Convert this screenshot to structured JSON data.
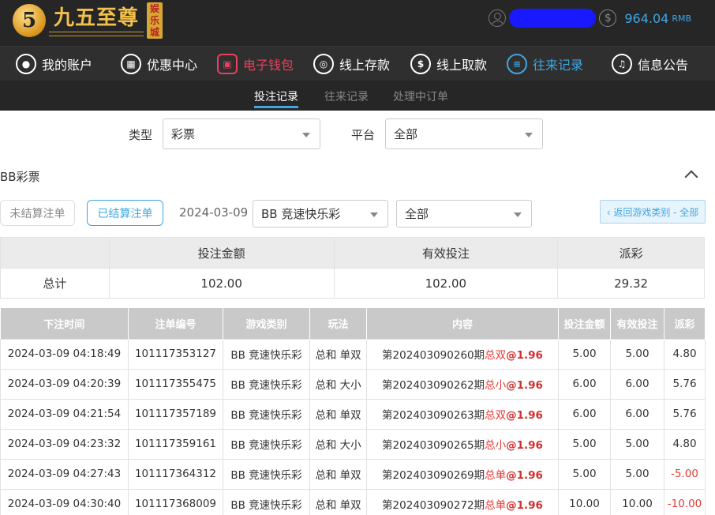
{
  "header": {
    "logo_title": "九五至尊",
    "logo_badge": "娱乐城",
    "balance": "964.04",
    "balance_unit": "RMB"
  },
  "mainnav": [
    {
      "label": "我的账户",
      "icon": "user-icon"
    },
    {
      "label": "优惠中心",
      "icon": "gift-icon"
    },
    {
      "label": "电子钱包",
      "icon": "wallet-icon"
    },
    {
      "label": "线上存款",
      "icon": "deposit-icon"
    },
    {
      "label": "线上取款",
      "icon": "withdraw-icon"
    },
    {
      "label": "往来记录",
      "icon": "records-icon"
    },
    {
      "label": "信息公告",
      "icon": "bell-icon"
    }
  ],
  "subnav": [
    "投注记录",
    "往来记录",
    "处理中订单"
  ],
  "filters": {
    "type_label": "类型",
    "type_value": "彩票",
    "platform_label": "平台",
    "platform_value": "全部"
  },
  "section": {
    "title": "BB彩票",
    "unsettled_label": "未结算注单",
    "settled_label": "已结算注单",
    "date": "2024-03-09",
    "game_value": "BB 竞速快乐彩",
    "scope_value": "全部",
    "back_label": "‹ 返回游戏类别 - 全部"
  },
  "summary": {
    "headers": [
      "投注金额",
      "有效投注",
      "派彩"
    ],
    "row_label": "总计",
    "values": [
      "102.00",
      "102.00",
      "29.32"
    ]
  },
  "bets": {
    "headers": [
      "下注时间",
      "注单编号",
      "游戏类别",
      "玩法",
      "内容",
      "投注金额",
      "有效投注",
      "派彩"
    ],
    "rows": [
      {
        "time": "2024-03-09 04:18:49",
        "id": "101117353127",
        "game": "BB 竞速快乐彩",
        "play": "总和 单双",
        "period": "第202403090260期",
        "pick": "总双",
        "odds": "@1.96",
        "amount": "5.00",
        "valid": "5.00",
        "payout": "4.80",
        "neg": false
      },
      {
        "time": "2024-03-09 04:20:39",
        "id": "101117355475",
        "game": "BB 竞速快乐彩",
        "play": "总和 大小",
        "period": "第202403090262期",
        "pick": "总小",
        "odds": "@1.96",
        "amount": "6.00",
        "valid": "6.00",
        "payout": "5.76",
        "neg": false
      },
      {
        "time": "2024-03-09 04:21:54",
        "id": "101117357189",
        "game": "BB 竞速快乐彩",
        "play": "总和 单双",
        "period": "第202403090263期",
        "pick": "总双",
        "odds": "@1.96",
        "amount": "6.00",
        "valid": "6.00",
        "payout": "5.76",
        "neg": false
      },
      {
        "time": "2024-03-09 04:23:32",
        "id": "101117359161",
        "game": "BB 竞速快乐彩",
        "play": "总和 大小",
        "period": "第202403090265期",
        "pick": "总小",
        "odds": "@1.96",
        "amount": "5.00",
        "valid": "5.00",
        "payout": "4.80",
        "neg": false
      },
      {
        "time": "2024-03-09 04:27:43",
        "id": "101117364312",
        "game": "BB 竞速快乐彩",
        "play": "总和 单双",
        "period": "第202403090269期",
        "pick": "总单",
        "odds": "@1.96",
        "amount": "5.00",
        "valid": "5.00",
        "payout": "-5.00",
        "neg": true
      },
      {
        "time": "2024-03-09 04:30:40",
        "id": "101117368009",
        "game": "BB 竞速快乐彩",
        "play": "总和 单双",
        "period": "第202403090272期",
        "pick": "总单",
        "odds": "@1.96",
        "amount": "10.00",
        "valid": "10.00",
        "payout": "-10.00",
        "neg": true
      }
    ]
  },
  "colors": {
    "accent": "#3fa6e0",
    "wallet": "#e8415c",
    "negative": "#e53935",
    "header_bg": "#262626"
  }
}
